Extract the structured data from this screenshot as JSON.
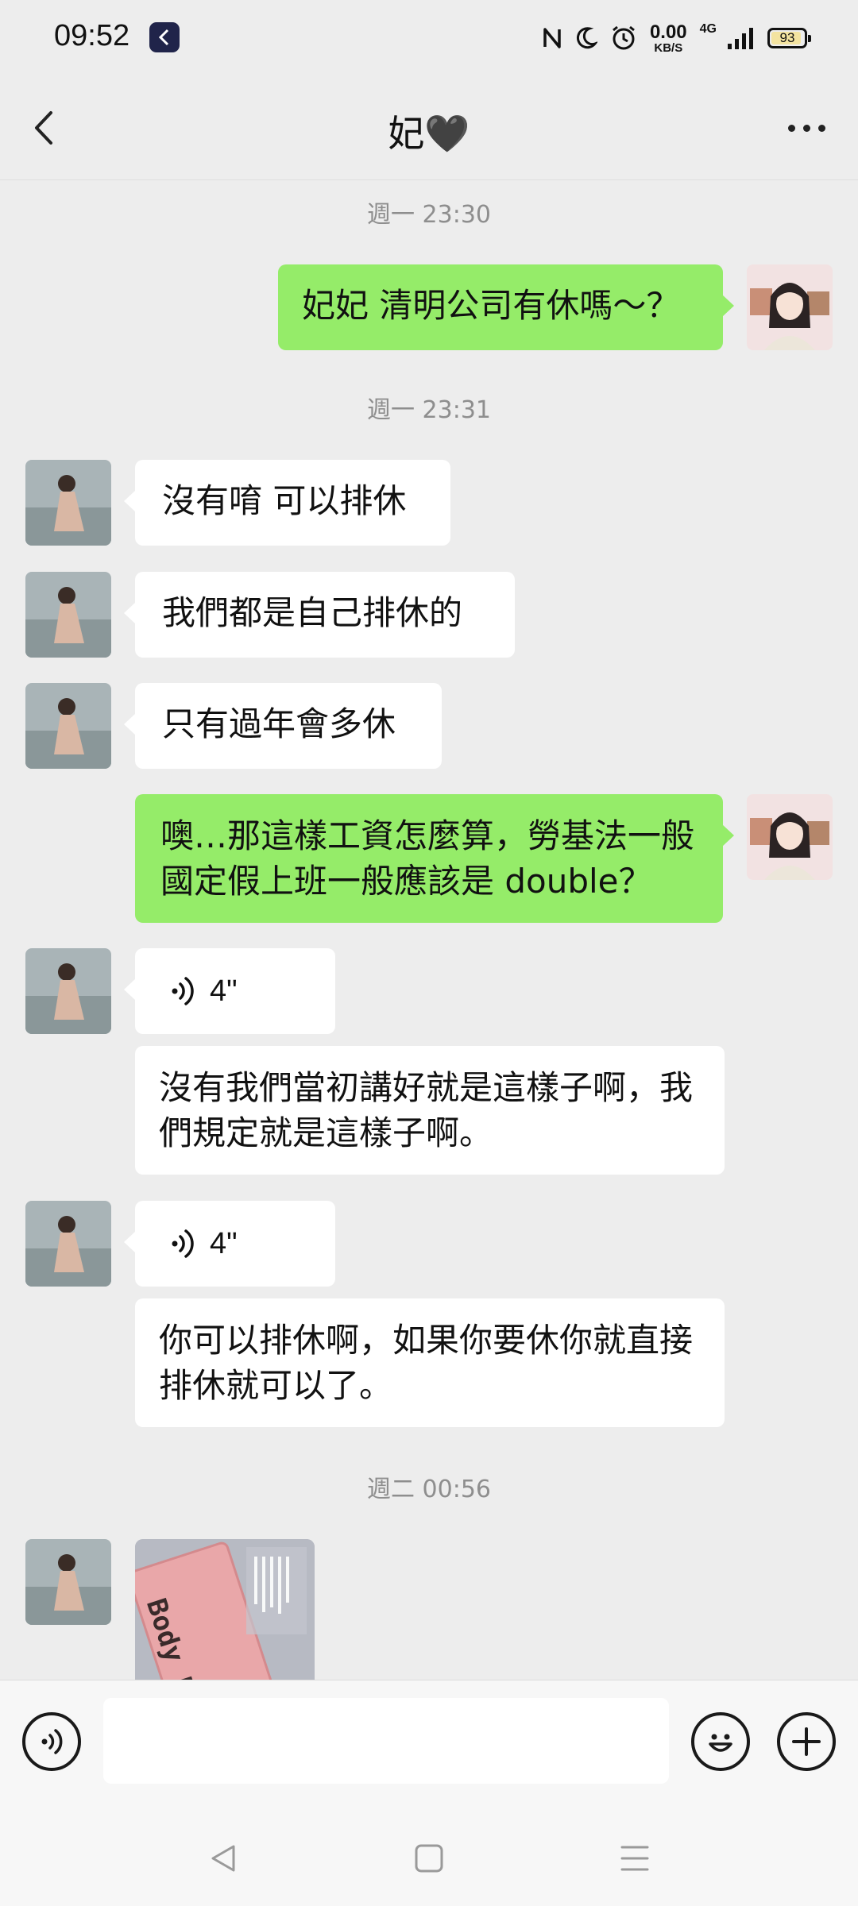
{
  "status_bar": {
    "time": "09:52",
    "net_speed_value": "0.00",
    "net_speed_unit": "KB/S",
    "network": "4G",
    "battery": "93",
    "battery_level": 0.93,
    "icons": [
      "nfc-icon",
      "moon-icon",
      "alarm-icon",
      "signal-icon",
      "battery-icon"
    ]
  },
  "header": {
    "title": "妃🖤"
  },
  "messages": {
    "ts1": "週一 23:30",
    "m1": "妃妃 清明公司有休嗎～？",
    "ts2": "週一 23:31",
    "m2": "沒有唷 可以排休",
    "m3": "我們都是自己排休的",
    "m4": "只有過年會多休",
    "m5": "噢…那這樣工資怎麼算，勞基法一般國定假上班一般應該是 double？",
    "voice1": "4\"",
    "m6": "沒有我們當初講好就是這樣子啊，我們規定就是這樣子啊。",
    "voice2": "4\"",
    "m7": "你可以排休啊，如果你要休你就直接排休就可以了。",
    "ts3": "週二 00:56",
    "image_text": "Body Lotion"
  },
  "input_bar": {
    "value": "",
    "icons": [
      "voice-icon",
      "emoji-icon",
      "plus-icon"
    ]
  },
  "nav_bar": {
    "icons": [
      "back-triangle-icon",
      "home-square-icon",
      "menu-icon"
    ]
  },
  "colors": {
    "background": "#ededed",
    "sent_bubble": "#95ec69",
    "received_bubble": "#ffffff",
    "timestamp": "#8e8e8e"
  }
}
